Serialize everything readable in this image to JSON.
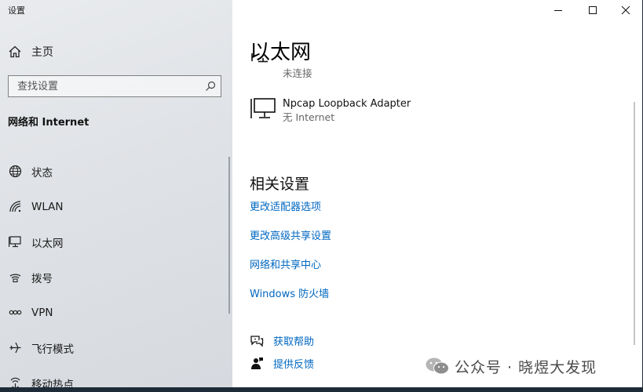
{
  "window": {
    "app_title": "设置",
    "controls": {
      "minimize": "minimize",
      "maximize": "maximize",
      "close": "close"
    }
  },
  "nav": {
    "home_label": "主页",
    "search_placeholder": "查找设置",
    "section_heading": "网络和 Internet",
    "items": [
      {
        "label": "状态",
        "icon": "globe-status-icon"
      },
      {
        "label": "WLAN",
        "icon": "wifi-icon"
      },
      {
        "label": "以太网",
        "icon": "ethernet-icon"
      },
      {
        "label": "拨号",
        "icon": "dialup-icon"
      },
      {
        "label": "VPN",
        "icon": "vpn-icon"
      },
      {
        "label": "飞行模式",
        "icon": "airplane-icon"
      },
      {
        "label": "移动热点",
        "icon": "hotspot-icon"
      }
    ]
  },
  "main": {
    "title": "以太网",
    "adapters": [
      {
        "name": "",
        "status": "未连接"
      },
      {
        "name": "Npcap Loopback Adapter",
        "status": "无 Internet"
      }
    ],
    "related_heading": "相关设置",
    "related_links": [
      "更改适配器选项",
      "更改高级共享设置",
      "网络和共享中心",
      "Windows 防火墙"
    ],
    "help": {
      "get_help": "获取帮助",
      "feedback": "提供反馈"
    }
  },
  "watermark": {
    "text": "公众号 · 晓煜大发现"
  },
  "colors": {
    "link": "#0067c0",
    "nav_bg": "#dfe2e6",
    "content_bg": "#ffffff"
  }
}
